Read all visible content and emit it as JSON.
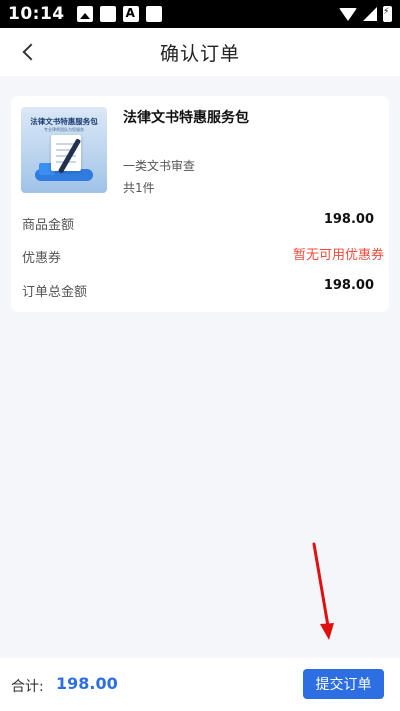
{
  "status_bar": {
    "time": "10:14"
  },
  "header": {
    "title": "确认订单"
  },
  "product": {
    "thumbnail_title": "法律文书特惠服务包",
    "thumbnail_subtitle": "专业律师团队为您服务",
    "name": "法律文书特惠服务包",
    "spec": "一类文书审查",
    "quantity": "共1件"
  },
  "summary": {
    "goods_amount_label": "商品金额",
    "goods_amount": "198.00",
    "coupon_label": "优惠券",
    "coupon_value": "暂无可用优惠券",
    "order_total_label": "订单总金额",
    "order_total": "198.00"
  },
  "footer": {
    "total_label": "合计:",
    "total_amount": "198.00",
    "submit_label": "提交订单"
  },
  "colors": {
    "accent": "#2d6fe2",
    "coupon_red": "#f04b3c",
    "annotation_red": "#e01010"
  }
}
